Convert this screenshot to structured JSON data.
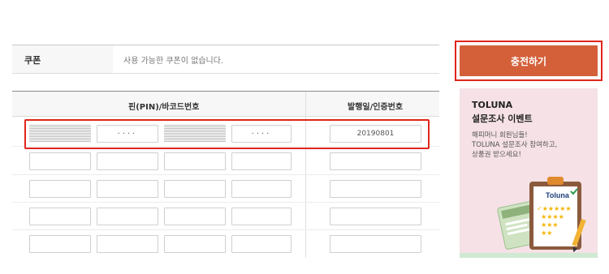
{
  "coupon": {
    "label": "쿠폰",
    "value": "사용 가능한 쿠폰이 없습니다."
  },
  "table": {
    "headers": {
      "pin": "핀(PIN)/바코드번호",
      "date": "발행일/인증번호"
    },
    "first_row": {
      "pin_mask_1": "····",
      "pin_mask_2": "····",
      "date_value": "20190801"
    },
    "empty_rows": 4
  },
  "sidebar": {
    "charge_button": "충전하기",
    "banner": {
      "brand": "TOLUNA",
      "title": "설문조사 이벤트",
      "subtitle_line1": "해피머니 회원님들!",
      "subtitle_line2": "TOLUNA 설문조사 참여하고,",
      "subtitle_line3": "상품권 받으세요!",
      "clipboard_logo": "Toluna"
    }
  },
  "colors": {
    "accent": "#d4603a",
    "highlight": "#e1251b",
    "banner_bg": "#f5e1e6"
  }
}
